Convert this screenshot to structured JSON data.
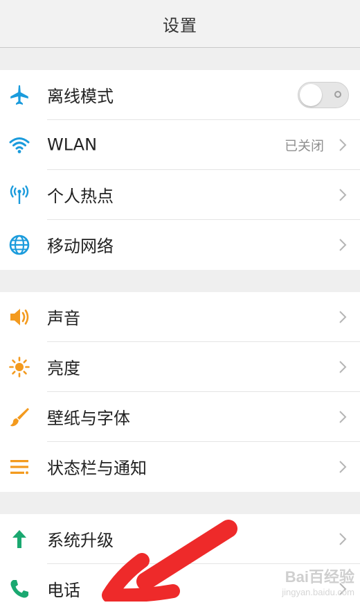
{
  "header": {
    "title": "设置"
  },
  "groups": [
    {
      "items": [
        {
          "label": "离线模式",
          "icon": "airplane-icon",
          "type": "toggle",
          "toggle_on": false
        },
        {
          "label": "WLAN",
          "icon": "wifi-icon",
          "value": "已关闭"
        },
        {
          "label": "个人热点",
          "icon": "hotspot-icon"
        },
        {
          "label": "移动网络",
          "icon": "globe-icon"
        }
      ]
    },
    {
      "items": [
        {
          "label": "声音",
          "icon": "speaker-icon"
        },
        {
          "label": "亮度",
          "icon": "sun-icon"
        },
        {
          "label": "壁纸与字体",
          "icon": "brush-icon"
        },
        {
          "label": "状态栏与通知",
          "icon": "list-icon"
        }
      ]
    },
    {
      "items": [
        {
          "label": "系统升级",
          "icon": "arrow-up-icon"
        },
        {
          "label": "电话",
          "icon": "phone-icon"
        }
      ]
    }
  ],
  "colors": {
    "blue_icon": "#1a9bdc",
    "orange_icon": "#f39a1e",
    "green_icon": "#1aa870",
    "annotation_red": "#ee2a2a"
  },
  "watermark": {
    "main": "Bai百经验",
    "sub": "jingyan.baidu.com"
  }
}
